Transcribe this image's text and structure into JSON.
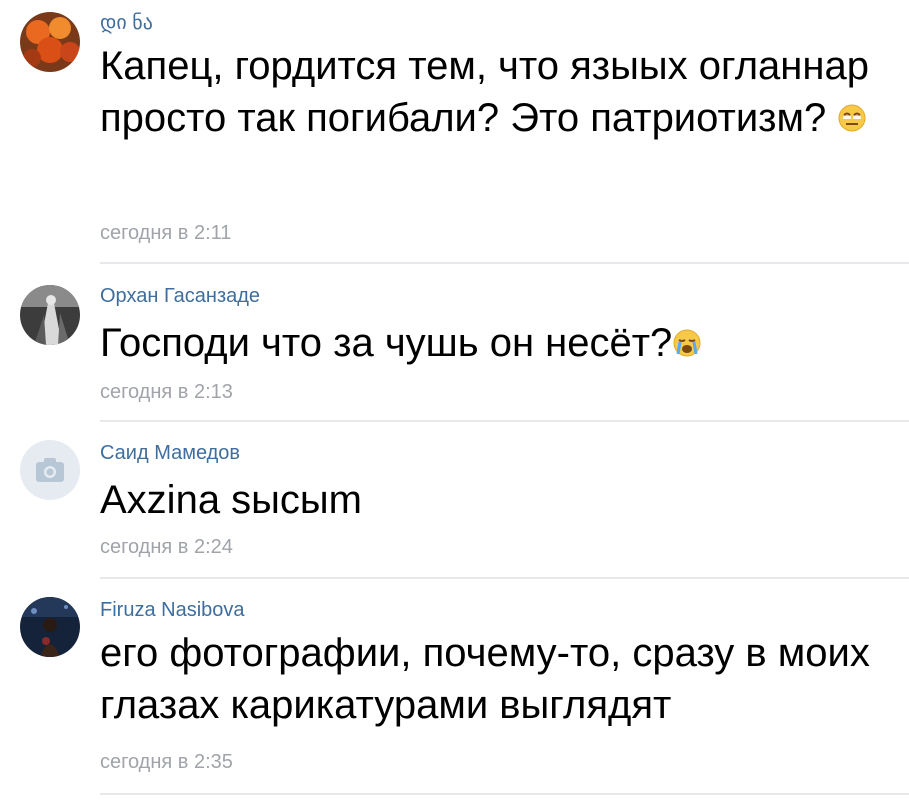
{
  "comments": [
    {
      "author": "დი ნა",
      "text": "Капец, гордится тем, что языых огланнар просто так погибали? Это патриотизм?",
      "emoji": "relieved-face-emoji",
      "time": "сегодня в 2:11"
    },
    {
      "author": "Орхан Гасанзаде",
      "text": "Господи что за чушь он несёт?",
      "emoji": "crying-face-emoji",
      "time": "сегодня в 2:13"
    },
    {
      "author": "Саид Мамедов",
      "text": "Axzina sысыm",
      "time": "сегодня в 2:24"
    },
    {
      "author": "Firuza Nasibova",
      "text": "его фотографии, почему-то, сразу в моих глазах карикатурами выглядят",
      "time": "сегодня в 2:35"
    }
  ],
  "colors": {
    "author": "#3f6e9c",
    "time": "#a0a4aa",
    "divider": "#e7e8ec",
    "placeholder_avatar": "#e5ebf1"
  }
}
